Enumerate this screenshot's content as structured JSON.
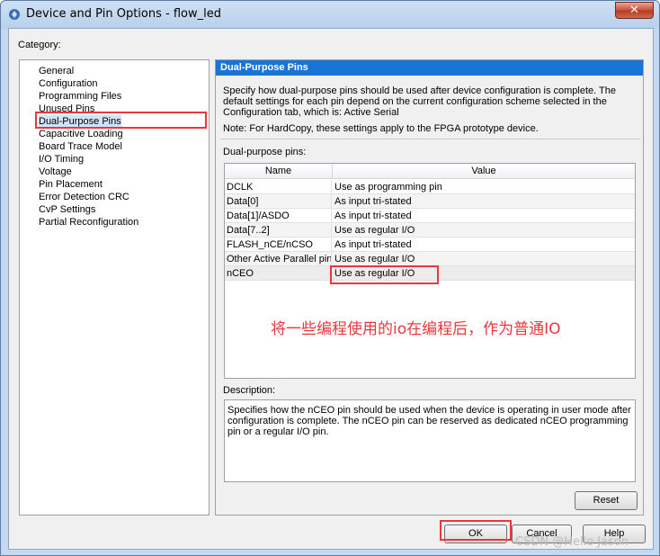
{
  "window": {
    "title": "Device and Pin Options - flow_led",
    "close_glyph": "✕",
    "app_icon": "quartus-icon"
  },
  "category": {
    "label": "Category:",
    "items": [
      {
        "label": "General"
      },
      {
        "label": "Configuration"
      },
      {
        "label": "Programming Files"
      },
      {
        "label": "Unused Pins"
      },
      {
        "label": "Dual-Purpose Pins",
        "selected": true
      },
      {
        "label": "Capacitive Loading"
      },
      {
        "label": "Board Trace Model"
      },
      {
        "label": "I/O Timing"
      },
      {
        "label": "Voltage"
      },
      {
        "label": "Pin Placement"
      },
      {
        "label": "Error Detection CRC"
      },
      {
        "label": "CvP Settings"
      },
      {
        "label": "Partial Reconfiguration"
      }
    ]
  },
  "panel": {
    "header": "Dual-Purpose Pins",
    "description": "Specify how dual-purpose pins should be used after device configuration is complete. The default settings for each pin depend on the current configuration scheme selected in the Configuration tab, which is:  Active Serial",
    "note": "Note: For HardCopy, these settings apply to the FPGA prototype device.",
    "pins_label": "Dual-purpose pins:",
    "table": {
      "columns": [
        "Name",
        "Value"
      ],
      "rows": [
        {
          "name": "DCLK",
          "value": "Use as programming pin"
        },
        {
          "name": "Data[0]",
          "value": "As input tri-stated"
        },
        {
          "name": "Data[1]/ASDO",
          "value": "As input tri-stated"
        },
        {
          "name": "Data[7..2]",
          "value": "Use as regular I/O"
        },
        {
          "name": "FLASH_nCE/nCSO",
          "value": "As input tri-stated"
        },
        {
          "name": "Other Active Parallel pins",
          "value": "Use as regular I/O"
        },
        {
          "name": "nCEO",
          "value": "Use as regular I/O"
        }
      ]
    },
    "annotation": "将一些编程使用的io在编程后，作为普通IO",
    "desc_label": "Description:",
    "desc_text": "Specifies how the nCEO pin should be used when the device is operating in user mode after configuration is complete. The nCEO pin can be reserved as dedicated nCEO programming pin or a regular I/O pin.",
    "reset_label": "Reset"
  },
  "buttons": {
    "ok": "OK",
    "cancel": "Cancel",
    "help": "Help"
  },
  "watermark": "CSDN @Hello Jason",
  "colors": {
    "header_blue": "#1874d6",
    "highlight_red": "#e8383d"
  }
}
